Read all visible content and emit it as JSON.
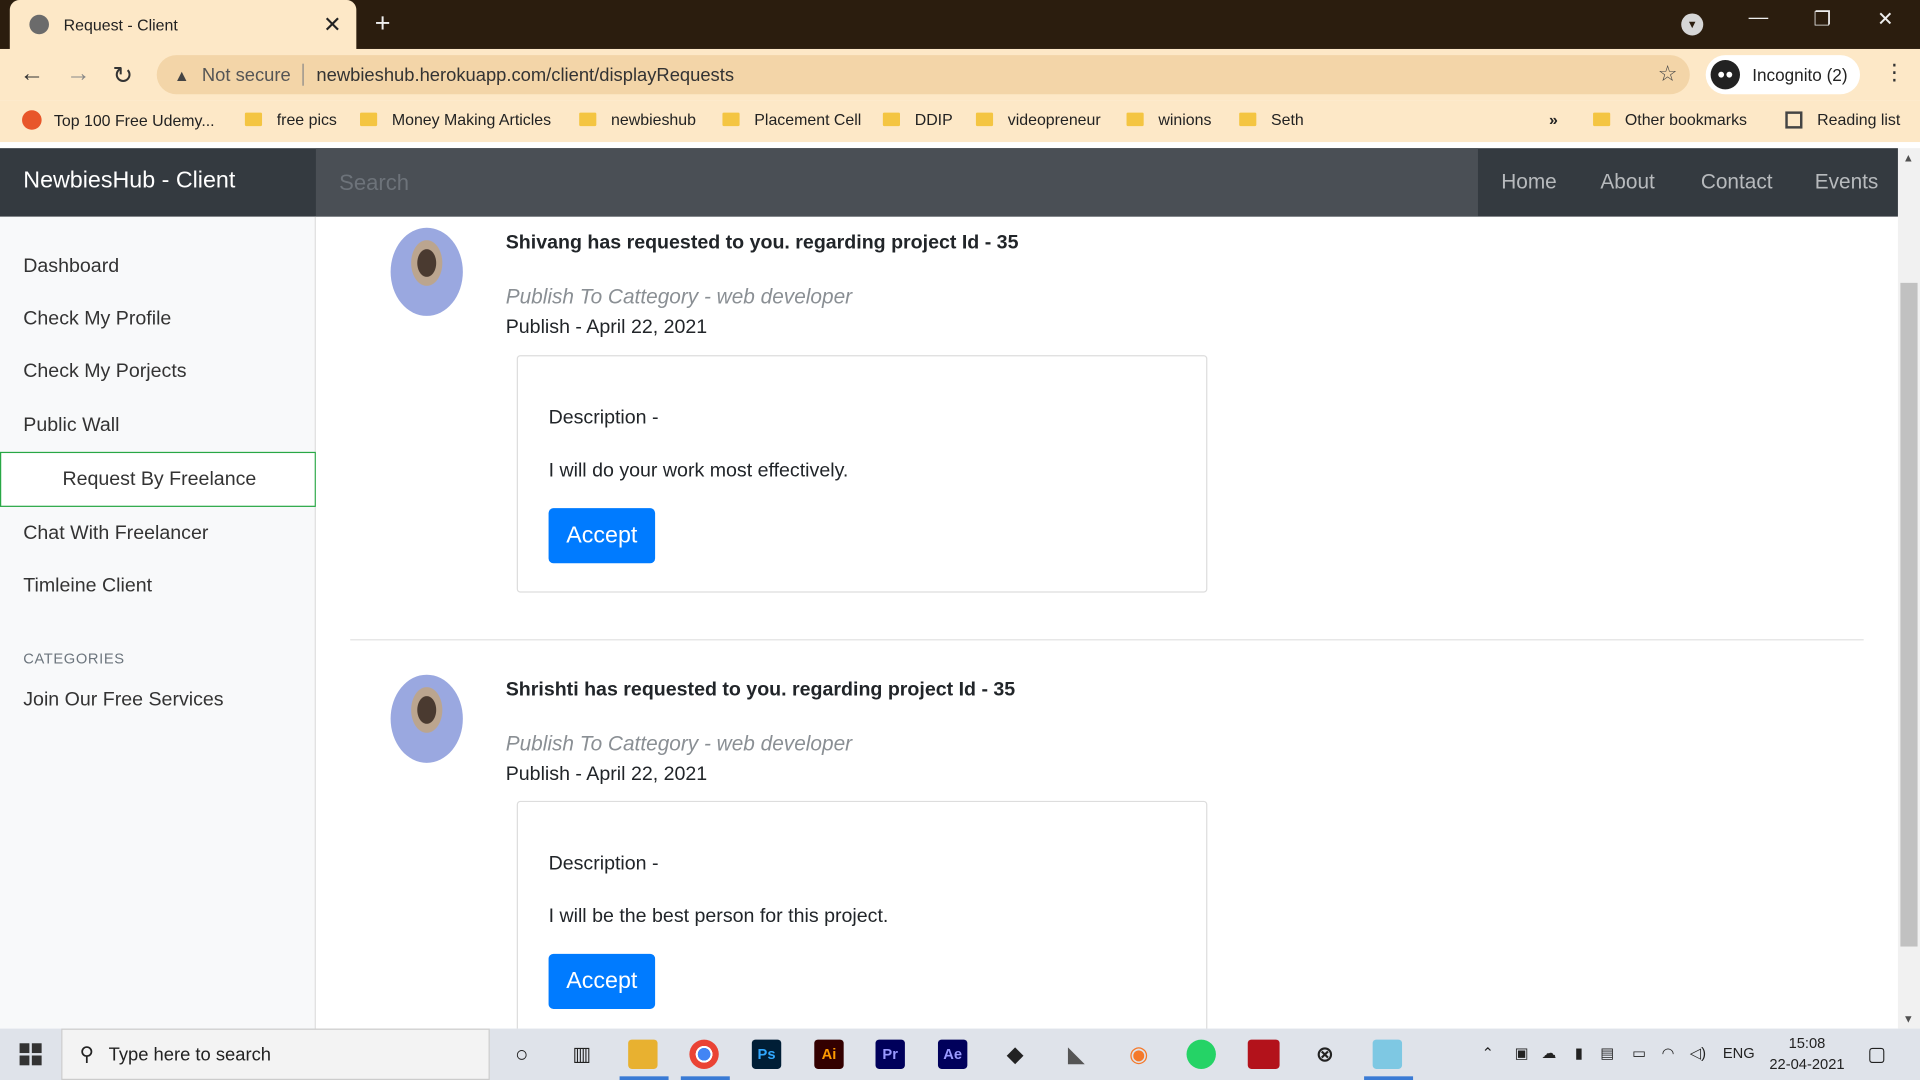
{
  "browser": {
    "tab_title": "Request - Client",
    "tab_close": "✕",
    "new_tab": "+",
    "not_secure": "Not secure",
    "url": "newbieshub.herokuapp.com/client/displayRequests",
    "incognito_label": "Incognito (2)",
    "bookmarks": [
      "Top 100 Free Udemy...",
      "free pics",
      "Money Making Articles",
      "newbieshub",
      "Placement Cell",
      "DDIP",
      "videopreneur",
      "winions",
      "Seth"
    ],
    "more_bookmarks": "»",
    "other_bookmarks": "Other bookmarks",
    "reading_list": "Reading list"
  },
  "site": {
    "brand": "NewbiesHub - Client",
    "search_placeholder": "Search",
    "nav": [
      "Home",
      "About",
      "Contact",
      "Events"
    ]
  },
  "sidebar": {
    "items": [
      "Dashboard",
      "Check My Profile",
      "Check My Porjects",
      "Public Wall"
    ],
    "active": "Request By Freelance",
    "items_after": [
      "Chat With Freelancer",
      "Timleine Client"
    ],
    "categories_heading": "CATEGORIES",
    "category_items": [
      "Join Our Free Services"
    ]
  },
  "requests": [
    {
      "title": "Shivang has requested to you. regarding project Id - 35",
      "category": "Publish To Cattegory - web developer",
      "date": "Publish - April 22, 2021",
      "description_label": "Description -",
      "description": "I will do your work most effectively.",
      "accept_label": "Accept"
    },
    {
      "title": "Shrishti has requested to you. regarding project Id - 35",
      "category": "Publish To Cattegory - web developer",
      "date": "Publish - April 22, 2021",
      "description_label": "Description -",
      "description": "I will be the best person for this project.",
      "accept_label": "Accept"
    }
  ],
  "taskbar": {
    "search_placeholder": "Type here to search",
    "apps": [
      "Ps",
      "Ai",
      "Pr",
      "Ae"
    ],
    "language": "ENG",
    "time": "15:08",
    "date": "22-04-2021"
  },
  "colors": {
    "accept_button": "#007bff",
    "navbar": "#343a40",
    "active_border": "#28a745"
  }
}
